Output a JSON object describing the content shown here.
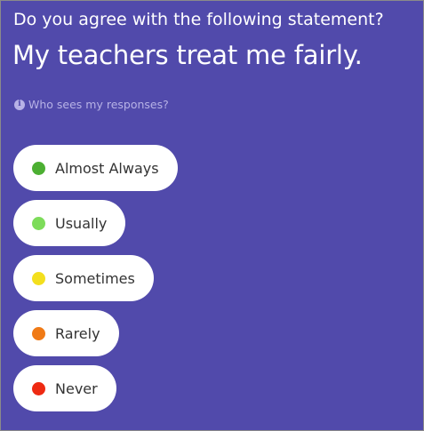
{
  "question": {
    "prompt": "Do you agree with the following statement?",
    "statement": "My teachers treat me fairly."
  },
  "privacy_link": {
    "icon": "info-icon",
    "icon_glyph": "i",
    "label": "Who sees my responses?"
  },
  "colors": {
    "background": "#514aab",
    "option_background": "#ffffff",
    "option_text": "#333333",
    "muted_link": "#b7b2e6"
  },
  "options": [
    {
      "label": "Almost Always",
      "color": "#4caf32"
    },
    {
      "label": "Usually",
      "color": "#7ddc5a"
    },
    {
      "label": "Sometimes",
      "color": "#f3df1e"
    },
    {
      "label": "Rarely",
      "color": "#f07a16"
    },
    {
      "label": "Never",
      "color": "#ee2a12"
    }
  ]
}
